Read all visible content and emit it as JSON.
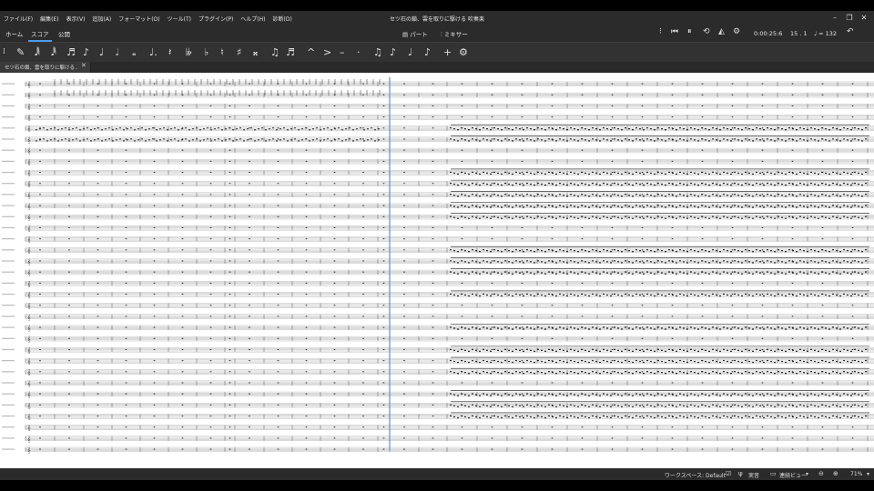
{
  "window": {
    "title": "セツ石の鎖、雲を取りに駆ける 吹奏楽",
    "minimize_icon": "minimize-icon",
    "maximize_icon": "restore-icon",
    "close_icon": "close-icon"
  },
  "menu": {
    "items": [
      "ファイル(F)",
      "編集(E)",
      "表示(V)",
      "追加(A)",
      "フォーマット(O)",
      "ツール(T)",
      "プラグイン(P)",
      "ヘルプ(H)",
      "診断(D)"
    ]
  },
  "tabs": {
    "home": "ホーム",
    "score": "スコア",
    "publish": "公開",
    "parts": "パート",
    "mixer": "ミキサー"
  },
  "playback": {
    "time": "0:00:25:6",
    "measure_beat": "15 . 1",
    "tempo": "♩ = 132"
  },
  "document_tab": {
    "label": "セツ石の鎖、雲を取りに駆ける...",
    "close": "✕"
  },
  "statusbar": {
    "workspace": "ワークスペース: Default",
    "concert_pitch": "実音",
    "view_mode": "連続ビュー",
    "zoom": "71%"
  },
  "colors": {
    "accent": "#4d9be8",
    "menubar_bg": "#2b2b2b",
    "toolbar_bg": "#323232",
    "score_bg": "#ffffff",
    "playback_cursor": "#5b8fd6"
  },
  "toolbar_icons": [
    "drag-handle-icon",
    "note-input-pen-icon",
    "64th-note-icon",
    "32nd-note-icon",
    "16th-note-icon",
    "eighth-note-icon",
    "quarter-note-icon",
    "half-note-icon",
    "whole-note-icon",
    "augmentation-dot-icon",
    "rest-icon",
    "double-flat-icon",
    "flat-icon",
    "natural-icon",
    "sharp-icon",
    "double-sharp-icon",
    "tie-icon",
    "slur-icon",
    "marcato-icon",
    "accent-icon",
    "tenuto-icon",
    "staccato-icon",
    "beam-icon",
    "flip-direction-icon",
    "tuplet-icon",
    "voice-icon",
    "add-icon",
    "settings-icon"
  ]
}
